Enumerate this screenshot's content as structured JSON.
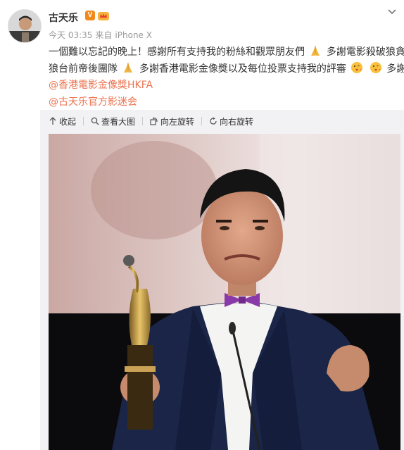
{
  "post": {
    "username": "古天乐",
    "verified_badge": "V",
    "meta": {
      "time": "今天 03:35",
      "source_prefix": "来自",
      "source": "iPhone X"
    },
    "text_lines": [
      "一個難以忘記的晚上！感謝所有支持我的粉絲和觀眾朋友們",
      "多謝電影殺破狼貪",
      "狼台前帝後團隊",
      "多謝香港電影金像獎以及每位投票支持我的評審",
      "多謝"
    ],
    "mentions": [
      "@香港電影金像獎HKFA",
      "@古天乐官方影迷会"
    ]
  },
  "toolbar": {
    "collapse": "收起",
    "view_large": "查看大图",
    "rotate_left": "向左旋转",
    "rotate_right": "向右旋转"
  },
  "colors": {
    "link": "#eb7350",
    "badge": "#f08a1c",
    "expanded_bg": "#f2f2f5"
  },
  "icons": [
    "dropdown-chevron-icon",
    "pray-emoji-icon",
    "kiss-emoji-icon",
    "collapse-arrow-icon",
    "magnifier-icon",
    "rotate-left-icon",
    "rotate-right-icon"
  ]
}
